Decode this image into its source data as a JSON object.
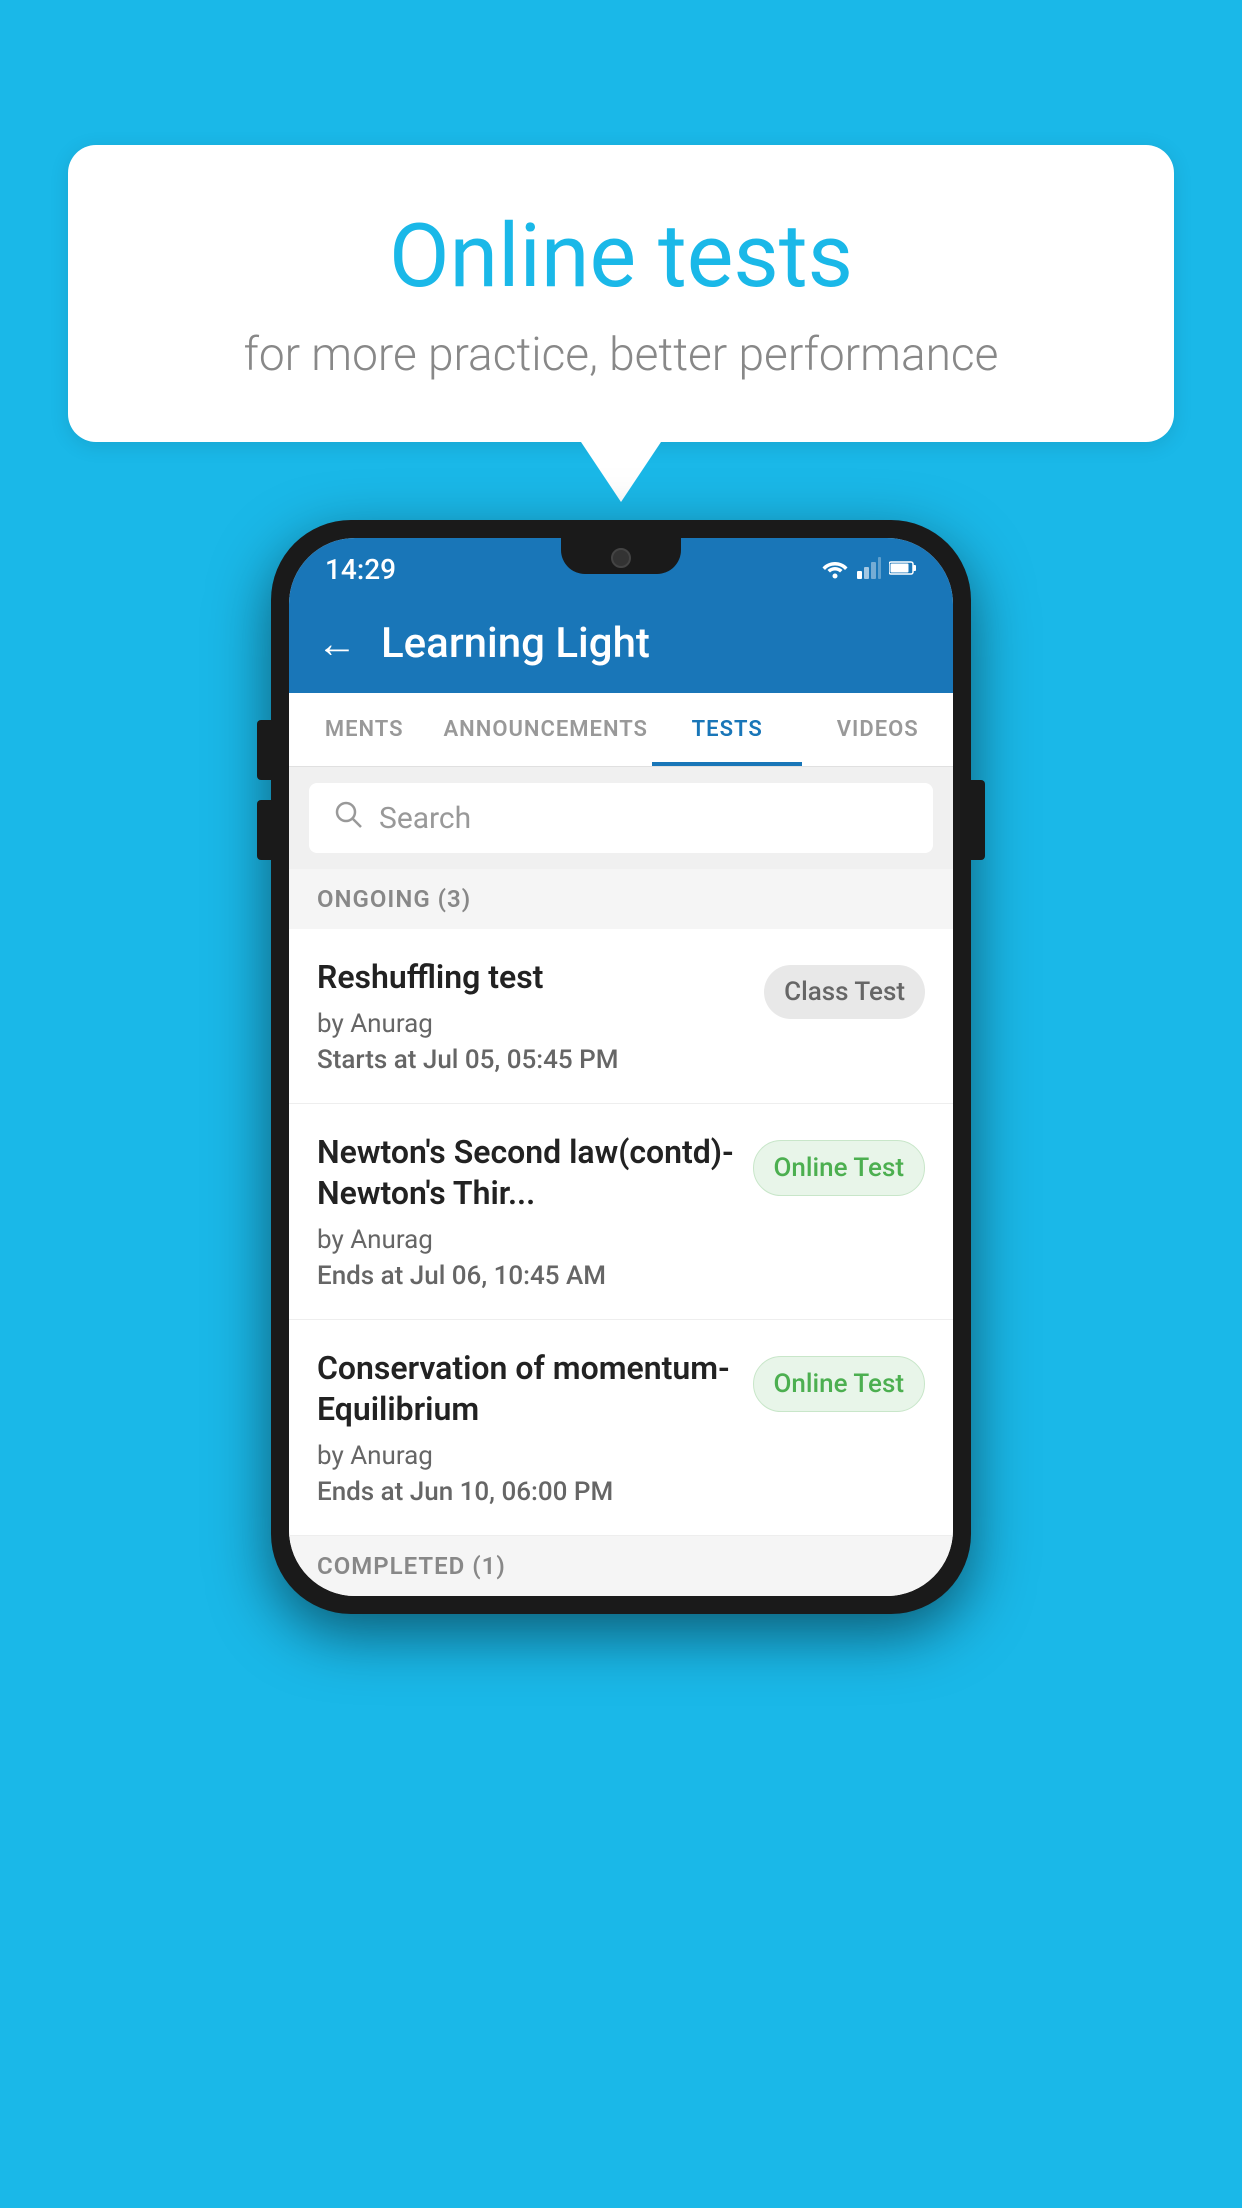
{
  "background_color": "#1ab8e8",
  "speech_bubble": {
    "title": "Online tests",
    "subtitle": "for more practice, better performance"
  },
  "status_bar": {
    "time": "14:29",
    "wifi": "▾",
    "signal": "◀",
    "battery": "▮"
  },
  "app_bar": {
    "back_icon": "←",
    "title": "Learning Light"
  },
  "tabs": [
    {
      "label": "MENTS",
      "active": false
    },
    {
      "label": "ANNOUNCEMENTS",
      "active": false
    },
    {
      "label": "TESTS",
      "active": true
    },
    {
      "label": "VIDEOS",
      "active": false
    }
  ],
  "search": {
    "placeholder": "Search"
  },
  "ongoing_section": {
    "label": "ONGOING (3)"
  },
  "tests": [
    {
      "title": "Reshuffling test",
      "author": "by Anurag",
      "date_label": "Starts at",
      "date_value": "Jul 05, 05:45 PM",
      "badge": "Class Test",
      "badge_type": "class"
    },
    {
      "title": "Newton's Second law(contd)-Newton's Thir...",
      "author": "by Anurag",
      "date_label": "Ends at",
      "date_value": "Jul 06, 10:45 AM",
      "badge": "Online Test",
      "badge_type": "online"
    },
    {
      "title": "Conservation of momentum-Equilibrium",
      "author": "by Anurag",
      "date_label": "Ends at",
      "date_value": "Jun 10, 06:00 PM",
      "badge": "Online Test",
      "badge_type": "online"
    }
  ],
  "completed_section": {
    "label": "COMPLETED (1)"
  }
}
